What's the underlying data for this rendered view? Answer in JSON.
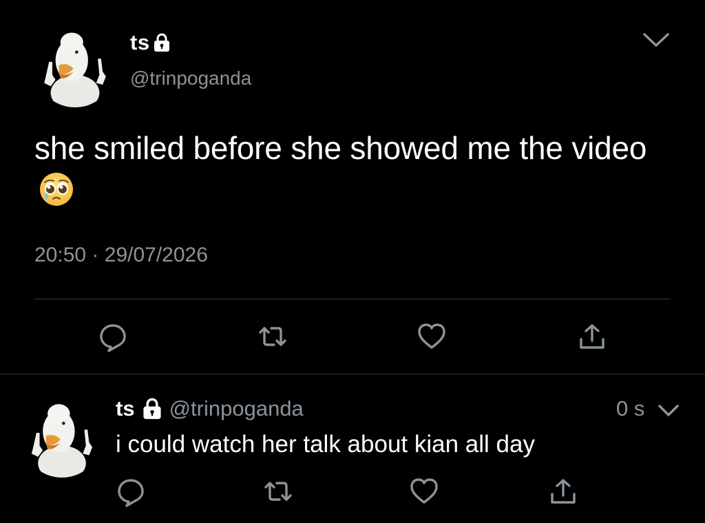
{
  "main_tweet": {
    "display_name": "ts",
    "handle": "@trinpoganda",
    "text": "she smiled before she showed me the video",
    "emoji": "pleading-face",
    "time": "20:50",
    "separator": "·",
    "date": "29/07/2026",
    "icons": [
      "lock-icon",
      "chevron-down-icon",
      "reply-icon",
      "retweet-icon",
      "like-icon",
      "share-icon"
    ]
  },
  "reply_tweet": {
    "display_name": "ts",
    "handle": "@trinpoganda",
    "relative_time": "0 s",
    "text": "i could watch her talk about kian all day",
    "icons": [
      "lock-icon",
      "chevron-down-icon",
      "reply-icon",
      "retweet-icon",
      "like-icon",
      "share-icon"
    ]
  },
  "colors": {
    "background": "#000000",
    "text": "#ffffff",
    "secondary_text": "#8b949a",
    "divider": "#3a3d40"
  }
}
